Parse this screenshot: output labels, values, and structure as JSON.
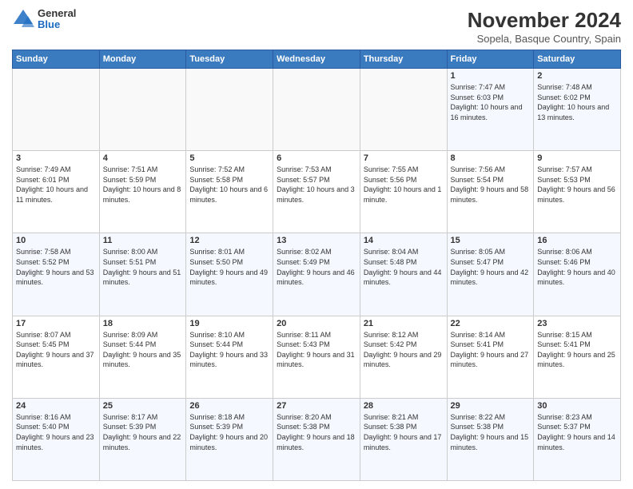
{
  "logo": {
    "general": "General",
    "blue": "Blue"
  },
  "title": "November 2024",
  "subtitle": "Sopela, Basque Country, Spain",
  "weekdays": [
    "Sunday",
    "Monday",
    "Tuesday",
    "Wednesday",
    "Thursday",
    "Friday",
    "Saturday"
  ],
  "weeks": [
    [
      {
        "day": "",
        "info": ""
      },
      {
        "day": "",
        "info": ""
      },
      {
        "day": "",
        "info": ""
      },
      {
        "day": "",
        "info": ""
      },
      {
        "day": "",
        "info": ""
      },
      {
        "day": "1",
        "info": "Sunrise: 7:47 AM\nSunset: 6:03 PM\nDaylight: 10 hours and 16 minutes."
      },
      {
        "day": "2",
        "info": "Sunrise: 7:48 AM\nSunset: 6:02 PM\nDaylight: 10 hours and 13 minutes."
      }
    ],
    [
      {
        "day": "3",
        "info": "Sunrise: 7:49 AM\nSunset: 6:01 PM\nDaylight: 10 hours and 11 minutes."
      },
      {
        "day": "4",
        "info": "Sunrise: 7:51 AM\nSunset: 5:59 PM\nDaylight: 10 hours and 8 minutes."
      },
      {
        "day": "5",
        "info": "Sunrise: 7:52 AM\nSunset: 5:58 PM\nDaylight: 10 hours and 6 minutes."
      },
      {
        "day": "6",
        "info": "Sunrise: 7:53 AM\nSunset: 5:57 PM\nDaylight: 10 hours and 3 minutes."
      },
      {
        "day": "7",
        "info": "Sunrise: 7:55 AM\nSunset: 5:56 PM\nDaylight: 10 hours and 1 minute."
      },
      {
        "day": "8",
        "info": "Sunrise: 7:56 AM\nSunset: 5:54 PM\nDaylight: 9 hours and 58 minutes."
      },
      {
        "day": "9",
        "info": "Sunrise: 7:57 AM\nSunset: 5:53 PM\nDaylight: 9 hours and 56 minutes."
      }
    ],
    [
      {
        "day": "10",
        "info": "Sunrise: 7:58 AM\nSunset: 5:52 PM\nDaylight: 9 hours and 53 minutes."
      },
      {
        "day": "11",
        "info": "Sunrise: 8:00 AM\nSunset: 5:51 PM\nDaylight: 9 hours and 51 minutes."
      },
      {
        "day": "12",
        "info": "Sunrise: 8:01 AM\nSunset: 5:50 PM\nDaylight: 9 hours and 49 minutes."
      },
      {
        "day": "13",
        "info": "Sunrise: 8:02 AM\nSunset: 5:49 PM\nDaylight: 9 hours and 46 minutes."
      },
      {
        "day": "14",
        "info": "Sunrise: 8:04 AM\nSunset: 5:48 PM\nDaylight: 9 hours and 44 minutes."
      },
      {
        "day": "15",
        "info": "Sunrise: 8:05 AM\nSunset: 5:47 PM\nDaylight: 9 hours and 42 minutes."
      },
      {
        "day": "16",
        "info": "Sunrise: 8:06 AM\nSunset: 5:46 PM\nDaylight: 9 hours and 40 minutes."
      }
    ],
    [
      {
        "day": "17",
        "info": "Sunrise: 8:07 AM\nSunset: 5:45 PM\nDaylight: 9 hours and 37 minutes."
      },
      {
        "day": "18",
        "info": "Sunrise: 8:09 AM\nSunset: 5:44 PM\nDaylight: 9 hours and 35 minutes."
      },
      {
        "day": "19",
        "info": "Sunrise: 8:10 AM\nSunset: 5:44 PM\nDaylight: 9 hours and 33 minutes."
      },
      {
        "day": "20",
        "info": "Sunrise: 8:11 AM\nSunset: 5:43 PM\nDaylight: 9 hours and 31 minutes."
      },
      {
        "day": "21",
        "info": "Sunrise: 8:12 AM\nSunset: 5:42 PM\nDaylight: 9 hours and 29 minutes."
      },
      {
        "day": "22",
        "info": "Sunrise: 8:14 AM\nSunset: 5:41 PM\nDaylight: 9 hours and 27 minutes."
      },
      {
        "day": "23",
        "info": "Sunrise: 8:15 AM\nSunset: 5:41 PM\nDaylight: 9 hours and 25 minutes."
      }
    ],
    [
      {
        "day": "24",
        "info": "Sunrise: 8:16 AM\nSunset: 5:40 PM\nDaylight: 9 hours and 23 minutes."
      },
      {
        "day": "25",
        "info": "Sunrise: 8:17 AM\nSunset: 5:39 PM\nDaylight: 9 hours and 22 minutes."
      },
      {
        "day": "26",
        "info": "Sunrise: 8:18 AM\nSunset: 5:39 PM\nDaylight: 9 hours and 20 minutes."
      },
      {
        "day": "27",
        "info": "Sunrise: 8:20 AM\nSunset: 5:38 PM\nDaylight: 9 hours and 18 minutes."
      },
      {
        "day": "28",
        "info": "Sunrise: 8:21 AM\nSunset: 5:38 PM\nDaylight: 9 hours and 17 minutes."
      },
      {
        "day": "29",
        "info": "Sunrise: 8:22 AM\nSunset: 5:38 PM\nDaylight: 9 hours and 15 minutes."
      },
      {
        "day": "30",
        "info": "Sunrise: 8:23 AM\nSunset: 5:37 PM\nDaylight: 9 hours and 14 minutes."
      }
    ]
  ]
}
